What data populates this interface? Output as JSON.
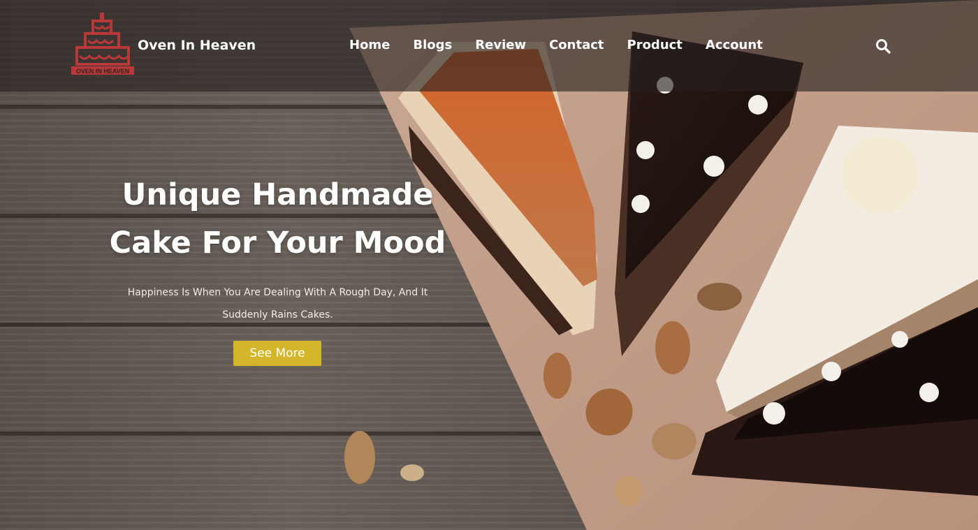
{
  "brand": {
    "name": "Oven In Heaven",
    "logo_text": "OVEN IN HEAVEN",
    "logo_color": "#b9393a"
  },
  "nav": {
    "items": [
      "Home",
      "Blogs",
      "Review",
      "Contact",
      "Product",
      "Account"
    ],
    "search_icon": "search-icon"
  },
  "hero": {
    "title_line1": "Unique Handmade",
    "title_line2": "Cake For Your Mood",
    "subtitle_line1": "Happiness Is When You Are Dealing With A Rough Day, And It",
    "subtitle_line2": "Suddenly Rains Cakes.",
    "cta_label": "See More",
    "cta_color": "#d4b62b"
  }
}
